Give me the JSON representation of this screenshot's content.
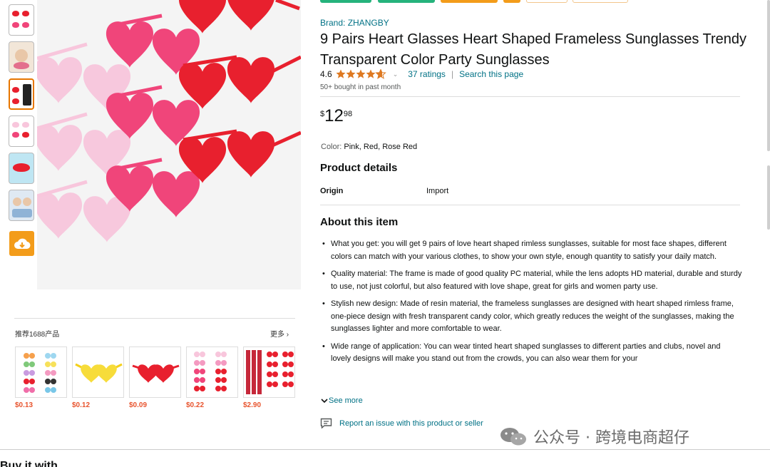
{
  "product": {
    "brand": "Brand: ZHANGBY",
    "title": "9 Pairs Heart Glasses Heart Shaped Frameless Sunglasses Trendy Transparent Color Party Sunglasses",
    "rating_value": "4.6",
    "rating_stars": 4.6,
    "ratings_count": "37 ratings",
    "search_page": "Search this page",
    "bought": "50+ bought in past month",
    "price_symbol": "$",
    "price_whole": "12",
    "price_fraction": "98",
    "color_label": "Color:",
    "color_value": "Pink, Red, Rose Red"
  },
  "details": {
    "heading": "Product details",
    "origin_key": "Origin",
    "origin_value": "Import"
  },
  "about": {
    "heading": "About this item",
    "bullets": [
      "What you get: you will get 9 pairs of love heart shaped rimless sunglasses, suitable for most face shapes, different colors can match with your various clothes, to show your own style, enough quantity to satisfy your daily match.",
      "Quality material: The frame is made of good quality PC material, while the lens adopts HD material, durable and sturdy to use, not just colorful, but also featured with love shape, great for girls and women party use.",
      "Stylish new design: Made of resin material, the frameless sunglasses are designed with heart shaped rimless frame, one-piece design with fresh transparent candy color, which greatly reduces the weight of the sunglasses, making the sunglasses lighter and more comfortable to wear.",
      "Wide range of application: You can wear tinted heart shaped sunglasses to different parties and clubs, novel and lovely designs will make you stand out from the crowds, you can also wear them for your"
    ],
    "see_more": "See more",
    "report": "Report an issue with this product or seller"
  },
  "recommend": {
    "title": "推荐1688产品",
    "more": "更多",
    "items": [
      {
        "price": "$0.13"
      },
      {
        "price": "$0.12"
      },
      {
        "price": "$0.09"
      },
      {
        "price": "$0.22"
      },
      {
        "price": "$2.90"
      }
    ]
  },
  "footer": {
    "buy_with": "Buy it with"
  },
  "watermark": {
    "text": "公众号 · 跨境电商超仔"
  },
  "colors": {
    "link": "#007185",
    "star": "#de7921",
    "accent": "#e77600",
    "download": "#f39c1a",
    "pink": "#f8c6dc",
    "rose_red": "#f0457a",
    "red": "#e8202e"
  }
}
